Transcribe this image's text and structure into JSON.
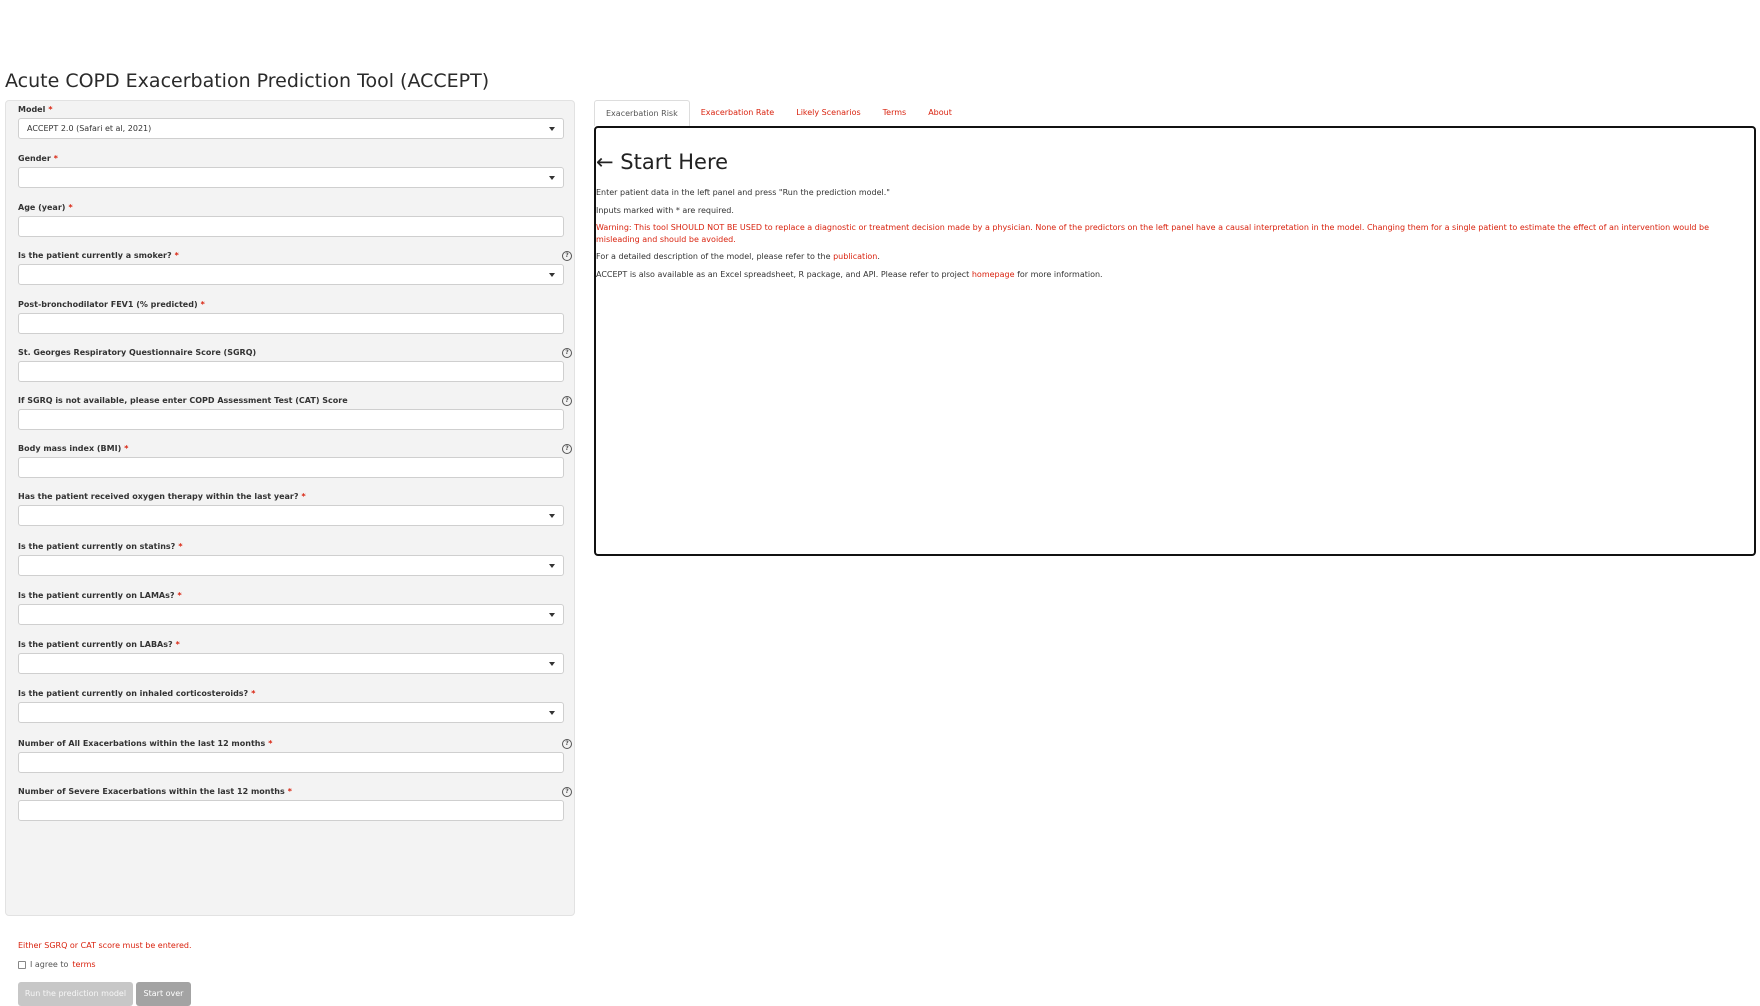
{
  "app": {
    "title": "Acute COPD Exacerbation Prediction Tool (ACCEPT)"
  },
  "form": {
    "fields": [
      {
        "label": "Model",
        "required": true,
        "type": "select",
        "value": "ACCEPT 2.0 (Safari et al, 2021)",
        "help": false
      },
      {
        "label": "Gender",
        "required": true,
        "type": "select",
        "value": "",
        "help": false
      },
      {
        "label": "Age (year)",
        "required": true,
        "type": "input",
        "value": "",
        "help": false
      },
      {
        "label": "Is the patient currently a smoker?",
        "required": true,
        "type": "select",
        "value": "",
        "help": true
      },
      {
        "label": "Post-bronchodilator FEV1 (% predicted)",
        "required": true,
        "type": "input",
        "value": "",
        "help": false
      },
      {
        "label": "St. Georges Respiratory Questionnaire Score (SGRQ)",
        "required": false,
        "type": "input",
        "value": "",
        "help": true
      },
      {
        "label": "If SGRQ is not available, please enter COPD Assessment Test (CAT) Score",
        "required": false,
        "type": "input",
        "value": "",
        "help": true
      },
      {
        "label": "Body mass index (BMI)",
        "required": true,
        "type": "input",
        "value": "",
        "help": true
      },
      {
        "label": "Has the patient received oxygen therapy within the last year?",
        "required": true,
        "type": "select",
        "value": "",
        "help": false
      },
      {
        "label": "Is the patient currently on statins?",
        "required": true,
        "type": "select",
        "value": "",
        "help": false
      },
      {
        "label": "Is the patient currently on LAMAs?",
        "required": true,
        "type": "select",
        "value": "",
        "help": false
      },
      {
        "label": "Is the patient currently on LABAs?",
        "required": true,
        "type": "select",
        "value": "",
        "help": false
      },
      {
        "label": "Is the patient currently on inhaled corticosteroids?",
        "required": true,
        "type": "select",
        "value": "",
        "help": false
      },
      {
        "label": "Number of All Exacerbations within the last 12 months",
        "required": true,
        "type": "input",
        "value": "",
        "help": true
      },
      {
        "label": "Number of Severe Exacerbations within the last 12 months",
        "required": true,
        "type": "input",
        "value": "",
        "help": true
      }
    ],
    "required_mark": "*",
    "help_icon": "?",
    "warning": "Either SGRQ or CAT score must be entered.",
    "agree_prefix": "I agree to",
    "agree_link": "terms",
    "run_button": "Run the prediction model",
    "start_over_button": "Start over"
  },
  "tabs": [
    {
      "label": "Exacerbation Risk",
      "active": true
    },
    {
      "label": "Exacerbation Rate",
      "active": false
    },
    {
      "label": "Likely Scenarios",
      "active": false
    },
    {
      "label": "Terms",
      "active": false
    },
    {
      "label": "About",
      "active": false
    }
  ],
  "main": {
    "heading": "← Start Here",
    "p1": "Enter patient data in the left panel and press \"Run the prediction model.\"",
    "p2": "Inputs marked with * are required.",
    "warning": "Warning: This tool SHOULD NOT BE USED to replace a diagnostic or treatment decision made by a physician. None of the predictors on the left panel have a causal interpretation in the model. Changing them for a single patient to estimate the effect of an intervention would be misleading and should be avoided.",
    "p4_prefix": "For a detailed description of the model, please refer to the",
    "p4_link": "publication",
    "p4_suffix": ".",
    "p5_prefix": "ACCEPT is also available as an Excel spreadsheet, R package, and API. Please refer to project",
    "p5_link": "homepage",
    "p5_suffix": "for more information."
  },
  "colors": {
    "accent": "#d9230f",
    "panel": "#f3f3f3"
  }
}
